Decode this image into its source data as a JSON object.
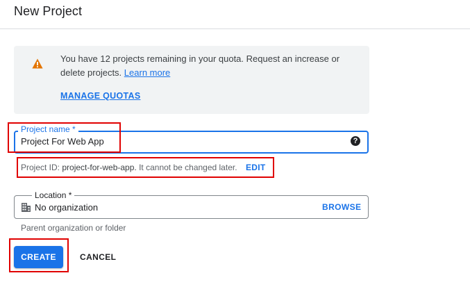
{
  "header": {
    "title": "New Project"
  },
  "quota": {
    "message": "You have 12 projects remaining in your quota. Request an increase or delete projects.",
    "learn_more": "Learn more",
    "manage_quotas": "MANAGE QUOTAS",
    "warning_icon": "warning-icon",
    "warning_color": "#e37400"
  },
  "project_name": {
    "label": "Project name *",
    "value": "Project For Web App",
    "help_icon": "help-circle-icon"
  },
  "project_id": {
    "prefix": "Project ID:",
    "id": "project-for-web-app.",
    "suffix": "It cannot be changed later.",
    "edit": "EDIT"
  },
  "location": {
    "label": "Location *",
    "value": "No organization",
    "browse": "BROWSE",
    "helper": "Parent organization or folder",
    "icon": "building-icon"
  },
  "actions": {
    "create": "CREATE",
    "cancel": "CANCEL"
  },
  "colors": {
    "accent": "#1a73e8",
    "highlight": "#e00000"
  }
}
